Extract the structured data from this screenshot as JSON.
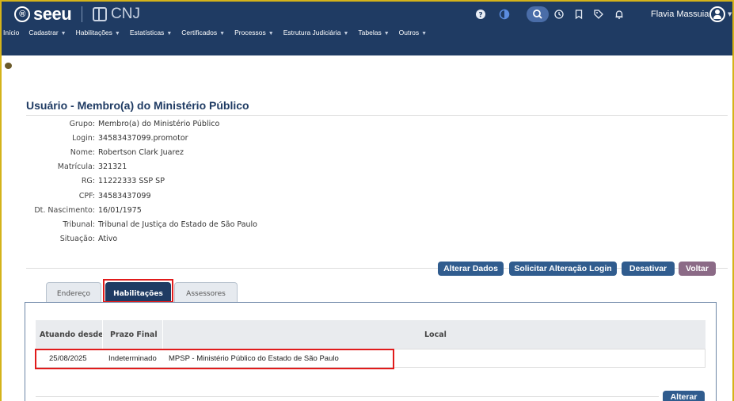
{
  "header": {
    "logo_text": "seeu",
    "logo_mark": "®",
    "cnj_text": "CNJ",
    "user_name": "Flavia Massuia",
    "icons": [
      "help-icon",
      "contrast-icon",
      "search-icon",
      "history-icon",
      "bookmark-icon",
      "tag-icon",
      "bell-icon",
      "user-avatar-icon"
    ]
  },
  "menu": [
    {
      "label": "Início",
      "has_dropdown": false
    },
    {
      "label": "Cadastrar",
      "has_dropdown": true
    },
    {
      "label": "Habilitações",
      "has_dropdown": true
    },
    {
      "label": "Estatísticas",
      "has_dropdown": true
    },
    {
      "label": "Certificados",
      "has_dropdown": true
    },
    {
      "label": "Processos",
      "has_dropdown": true
    },
    {
      "label": "Estrutura Judiciária",
      "has_dropdown": true
    },
    {
      "label": "Tabelas",
      "has_dropdown": true
    },
    {
      "label": "Outros",
      "has_dropdown": true
    }
  ],
  "page": {
    "title": "Usuário - Membro(a) do Ministério Público"
  },
  "info": [
    {
      "label": "Grupo:",
      "value": "Membro(a) do Ministério Público"
    },
    {
      "label": "Login:",
      "value": "34583437099.promotor"
    },
    {
      "label": "Nome:",
      "value": "Robertson Clark Juarez"
    },
    {
      "label": "Matrícula:",
      "value": "321321"
    },
    {
      "label": "RG:",
      "value": "11222333 SSP SP"
    },
    {
      "label": "CPF:",
      "value": "34583437099"
    },
    {
      "label": "Dt. Nascimento:",
      "value": "16/01/1975"
    },
    {
      "label": "Tribunal:",
      "value": "Tribunal de Justiça do Estado de São Paulo"
    },
    {
      "label": "Situação:",
      "value": "Ativo"
    }
  ],
  "actions": {
    "alterar_dados": "Alterar Dados",
    "solicitar_alteracao_login": "Solicitar Alteração Login",
    "desativar": "Desativar",
    "voltar": "Voltar"
  },
  "tabs": [
    {
      "label": "Endereço",
      "active": false
    },
    {
      "label": "Habilitações",
      "active": true
    },
    {
      "label": "Assessores",
      "active": false
    }
  ],
  "table": {
    "columns": [
      "Atuando desde",
      "Prazo Final",
      "Local"
    ],
    "rows": [
      [
        "25/08/2025",
        "Indeterminado",
        "MPSP - Ministério Público do Estado de São Paulo"
      ]
    ]
  },
  "footer": {
    "alterar": "Alterar"
  },
  "colors": {
    "header_bg": "#1f3b63",
    "primary_button": "#305c8e",
    "voltar_button": "#8b6a86",
    "highlight": "#e11b1b"
  }
}
